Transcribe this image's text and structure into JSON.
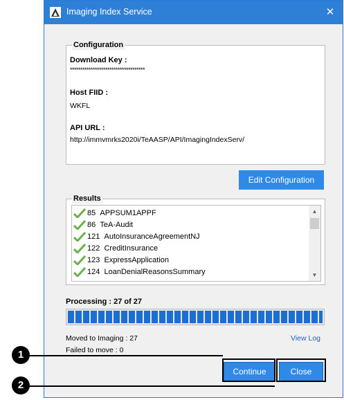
{
  "window": {
    "title": "Imaging Index Service",
    "close_glyph": "✕"
  },
  "configuration": {
    "legend": "Configuration",
    "download_key_label": "Download Key :",
    "download_key_value": "************************************",
    "host_fiid_label": "Host FIID :",
    "host_fiid_value": "WKFL",
    "api_url_label": "API URL :",
    "api_url_value": "http://immvmrks2020i/TeAASP/API/ImagingIndexServ/",
    "edit_button": "Edit Configuration"
  },
  "results": {
    "legend": "Results",
    "items": [
      {
        "id": "85",
        "name": "APPSUM1APPF",
        "status_icon": "check-icon"
      },
      {
        "id": "86",
        "name": "TeA-Audit",
        "status_icon": "check-icon"
      },
      {
        "id": "121",
        "name": "AutoInsuranceAgreementNJ",
        "status_icon": "check-icon"
      },
      {
        "id": "122",
        "name": "CreditInsurance",
        "status_icon": "check-icon"
      },
      {
        "id": "123",
        "name": "ExpressApplication",
        "status_icon": "check-icon"
      },
      {
        "id": "124",
        "name": "LoanDenialReasonsSummary",
        "status_icon": "check-icon"
      }
    ]
  },
  "processing": {
    "label": "Processing : 27 of 27",
    "progress_fraction": 1.0
  },
  "status": {
    "moved": "Moved to Imaging : 27",
    "failed": "Failed to move : 0",
    "view_log": "View Log"
  },
  "buttons": {
    "continue": "Continue",
    "close": "Close"
  },
  "callouts": [
    "1",
    "2"
  ],
  "colors": {
    "titlebar": "#2e7fd6",
    "button": "#2e8ae6",
    "check": "#6ab04c",
    "link": "#1a5fc7"
  }
}
